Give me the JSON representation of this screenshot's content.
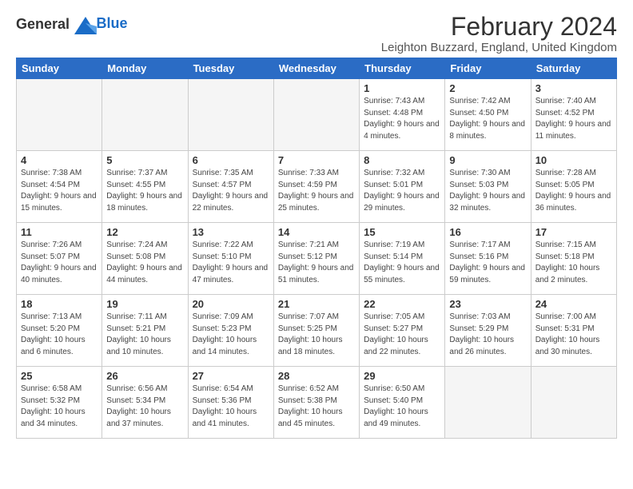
{
  "logo": {
    "general": "General",
    "blue": "Blue"
  },
  "title": "February 2024",
  "location": "Leighton Buzzard, England, United Kingdom",
  "days_of_week": [
    "Sunday",
    "Monday",
    "Tuesday",
    "Wednesday",
    "Thursday",
    "Friday",
    "Saturday"
  ],
  "weeks": [
    [
      {
        "day": "",
        "info": ""
      },
      {
        "day": "",
        "info": ""
      },
      {
        "day": "",
        "info": ""
      },
      {
        "day": "",
        "info": ""
      },
      {
        "day": "1",
        "info": "Sunrise: 7:43 AM\nSunset: 4:48 PM\nDaylight: 9 hours\nand 4 minutes."
      },
      {
        "day": "2",
        "info": "Sunrise: 7:42 AM\nSunset: 4:50 PM\nDaylight: 9 hours\nand 8 minutes."
      },
      {
        "day": "3",
        "info": "Sunrise: 7:40 AM\nSunset: 4:52 PM\nDaylight: 9 hours\nand 11 minutes."
      }
    ],
    [
      {
        "day": "4",
        "info": "Sunrise: 7:38 AM\nSunset: 4:54 PM\nDaylight: 9 hours\nand 15 minutes."
      },
      {
        "day": "5",
        "info": "Sunrise: 7:37 AM\nSunset: 4:55 PM\nDaylight: 9 hours\nand 18 minutes."
      },
      {
        "day": "6",
        "info": "Sunrise: 7:35 AM\nSunset: 4:57 PM\nDaylight: 9 hours\nand 22 minutes."
      },
      {
        "day": "7",
        "info": "Sunrise: 7:33 AM\nSunset: 4:59 PM\nDaylight: 9 hours\nand 25 minutes."
      },
      {
        "day": "8",
        "info": "Sunrise: 7:32 AM\nSunset: 5:01 PM\nDaylight: 9 hours\nand 29 minutes."
      },
      {
        "day": "9",
        "info": "Sunrise: 7:30 AM\nSunset: 5:03 PM\nDaylight: 9 hours\nand 32 minutes."
      },
      {
        "day": "10",
        "info": "Sunrise: 7:28 AM\nSunset: 5:05 PM\nDaylight: 9 hours\nand 36 minutes."
      }
    ],
    [
      {
        "day": "11",
        "info": "Sunrise: 7:26 AM\nSunset: 5:07 PM\nDaylight: 9 hours\nand 40 minutes."
      },
      {
        "day": "12",
        "info": "Sunrise: 7:24 AM\nSunset: 5:08 PM\nDaylight: 9 hours\nand 44 minutes."
      },
      {
        "day": "13",
        "info": "Sunrise: 7:22 AM\nSunset: 5:10 PM\nDaylight: 9 hours\nand 47 minutes."
      },
      {
        "day": "14",
        "info": "Sunrise: 7:21 AM\nSunset: 5:12 PM\nDaylight: 9 hours\nand 51 minutes."
      },
      {
        "day": "15",
        "info": "Sunrise: 7:19 AM\nSunset: 5:14 PM\nDaylight: 9 hours\nand 55 minutes."
      },
      {
        "day": "16",
        "info": "Sunrise: 7:17 AM\nSunset: 5:16 PM\nDaylight: 9 hours\nand 59 minutes."
      },
      {
        "day": "17",
        "info": "Sunrise: 7:15 AM\nSunset: 5:18 PM\nDaylight: 10 hours\nand 2 minutes."
      }
    ],
    [
      {
        "day": "18",
        "info": "Sunrise: 7:13 AM\nSunset: 5:20 PM\nDaylight: 10 hours\nand 6 minutes."
      },
      {
        "day": "19",
        "info": "Sunrise: 7:11 AM\nSunset: 5:21 PM\nDaylight: 10 hours\nand 10 minutes."
      },
      {
        "day": "20",
        "info": "Sunrise: 7:09 AM\nSunset: 5:23 PM\nDaylight: 10 hours\nand 14 minutes."
      },
      {
        "day": "21",
        "info": "Sunrise: 7:07 AM\nSunset: 5:25 PM\nDaylight: 10 hours\nand 18 minutes."
      },
      {
        "day": "22",
        "info": "Sunrise: 7:05 AM\nSunset: 5:27 PM\nDaylight: 10 hours\nand 22 minutes."
      },
      {
        "day": "23",
        "info": "Sunrise: 7:03 AM\nSunset: 5:29 PM\nDaylight: 10 hours\nand 26 minutes."
      },
      {
        "day": "24",
        "info": "Sunrise: 7:00 AM\nSunset: 5:31 PM\nDaylight: 10 hours\nand 30 minutes."
      }
    ],
    [
      {
        "day": "25",
        "info": "Sunrise: 6:58 AM\nSunset: 5:32 PM\nDaylight: 10 hours\nand 34 minutes."
      },
      {
        "day": "26",
        "info": "Sunrise: 6:56 AM\nSunset: 5:34 PM\nDaylight: 10 hours\nand 37 minutes."
      },
      {
        "day": "27",
        "info": "Sunrise: 6:54 AM\nSunset: 5:36 PM\nDaylight: 10 hours\nand 41 minutes."
      },
      {
        "day": "28",
        "info": "Sunrise: 6:52 AM\nSunset: 5:38 PM\nDaylight: 10 hours\nand 45 minutes."
      },
      {
        "day": "29",
        "info": "Sunrise: 6:50 AM\nSunset: 5:40 PM\nDaylight: 10 hours\nand 49 minutes."
      },
      {
        "day": "",
        "info": ""
      },
      {
        "day": "",
        "info": ""
      }
    ]
  ]
}
